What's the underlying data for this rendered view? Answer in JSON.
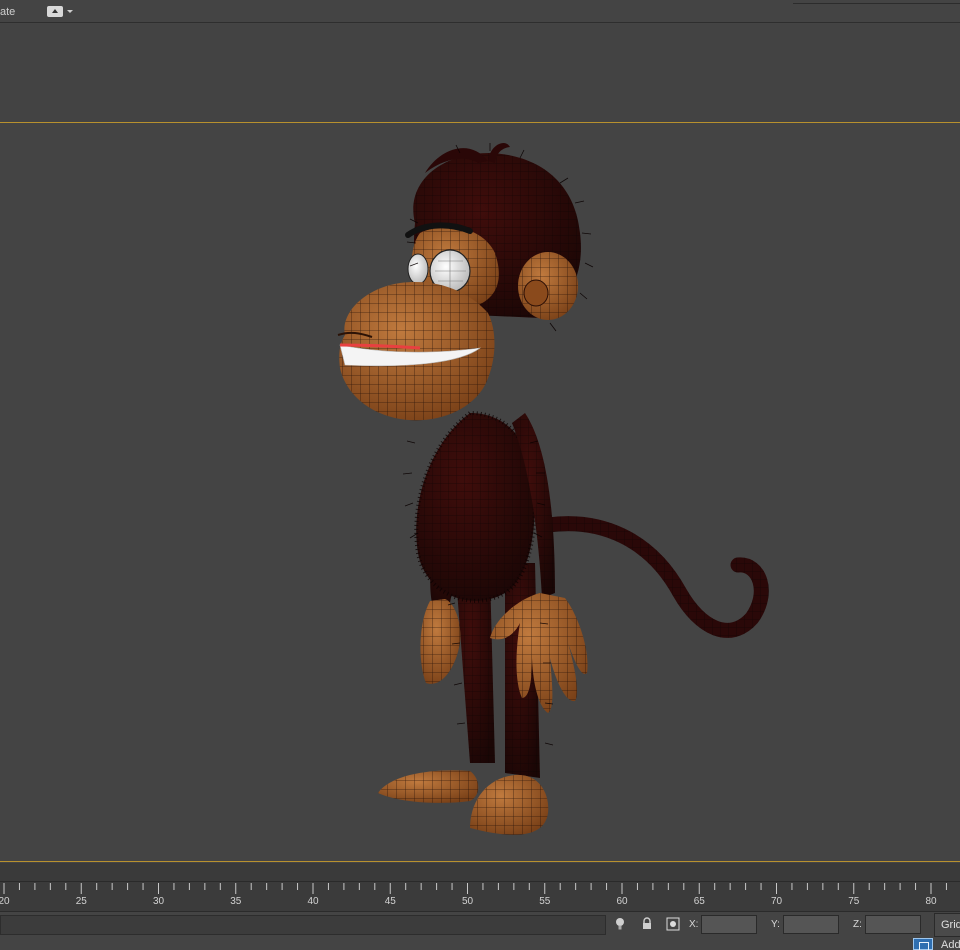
{
  "toolbar": {
    "partial_label": "ate",
    "viewport_menu_icon": "viewport-shading-icon"
  },
  "viewport": {
    "border_color": "#b8912e",
    "background": "#444444",
    "scene_object": "cartoon monkey wireframe model"
  },
  "timeline": {
    "tick_labels": [
      "20",
      "25",
      "30",
      "35",
      "40",
      "45",
      "50",
      "55",
      "60",
      "65",
      "70",
      "75",
      "80"
    ]
  },
  "status": {
    "icons": [
      "lightbulb-icon",
      "lock-icon",
      "transform-mode-icon"
    ],
    "x_label": "X:",
    "y_label": "Y:",
    "z_label": "Z:",
    "x_value": "",
    "y_value": "",
    "z_value": "",
    "grid_label": "Grid",
    "add_label": "Add"
  }
}
